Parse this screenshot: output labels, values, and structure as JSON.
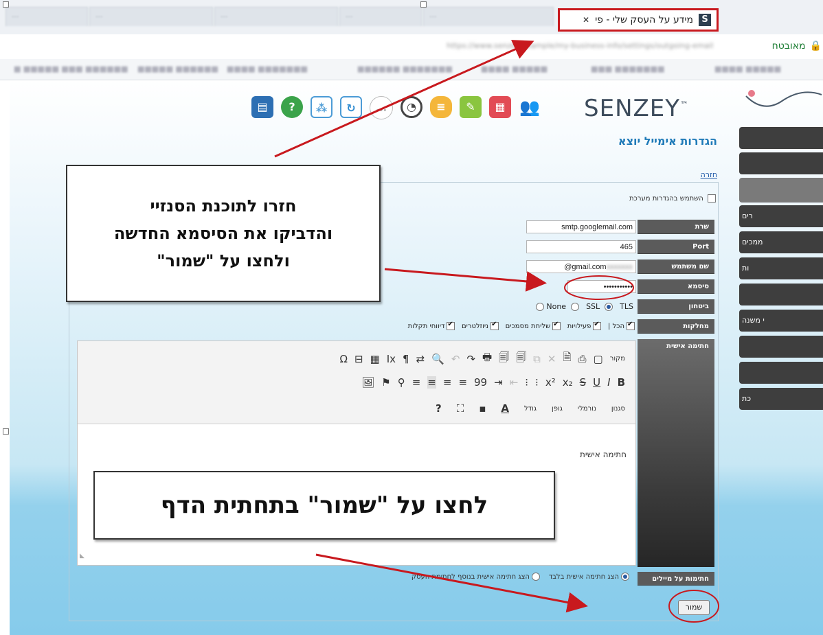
{
  "browser": {
    "active_tab_title": "מידע על העסק שלי - פי",
    "active_tab_favicon": "S",
    "close_label": "✕",
    "secure_label": "מאובטח",
    "background_tabs": [
      "···",
      "···",
      "···",
      "···",
      "···"
    ]
  },
  "app": {
    "logo_text": "SENZEY",
    "logo_mark": "™",
    "toolbar_icons": [
      "contacts-icon",
      "help-icon",
      "feet-icon",
      "sync-icon",
      "chat-bubble-icon",
      "clock-icon",
      "messages-icon",
      "notes-icon",
      "calendar-icon",
      "users-icon"
    ],
    "sidebar_items": [
      "",
      "",
      "",
      "רים",
      "ממכים",
      "ות",
      "",
      "י משנה",
      "",
      "",
      "כת"
    ]
  },
  "settings": {
    "title": "הגדרות אימייל יוצא",
    "help_link": "חזרה",
    "use_system_label": "השתמש בהגדרות מערכת",
    "fields": {
      "server_label": "שרת",
      "server_value": "smtp.googlemail.com",
      "port_label": "Port",
      "port_value": "465",
      "user_label": "שם משתמש",
      "user_value": "@gmail.com",
      "password_label": "סיסמא",
      "password_value": "•••••••••••",
      "security_label": "ביטחון",
      "departments_label": "מחלקות",
      "signature_label": "חתימה אישית",
      "signature_mode_label": "חתימות על מיילים"
    },
    "security_options": [
      {
        "label": "None"
      },
      {
        "label": "SSL"
      },
      {
        "label": "TLS"
      }
    ],
    "departments": [
      {
        "label": "הכל |"
      },
      {
        "label": "פעילויות"
      },
      {
        "label": "שליחת מסמכים"
      },
      {
        "label": "ניוזלטרים"
      },
      {
        "label": "דיווחי תקלות"
      }
    ],
    "editor": {
      "row1": [
        "מקור",
        "▢",
        "⎙",
        "🗎",
        "✕",
        "⧉",
        "🗐",
        "🗐",
        "🖶",
        "↷",
        "↶",
        "🔍",
        "⇄",
        "¶",
        "Ix",
        "▦",
        "⊟",
        "Ω"
      ],
      "row2": [
        "B",
        "I",
        "U",
        "S",
        "x₂",
        "x²",
        "⁝",
        "⁝",
        "⇤",
        "⇥",
        "99",
        "≡",
        "≡",
        "≡",
        "≡",
        "⚲",
        "⚑",
        "🖼"
      ],
      "row3": [
        "סגנון",
        "נורמלי",
        "גופן",
        "גודל",
        "A",
        "▪",
        "⛶",
        "?"
      ],
      "content": "חתימה אישית"
    },
    "signature_options": [
      {
        "label": "הצג חתימה אישית בלבד"
      },
      {
        "label": "הצג חתימה אישית בנוסף לחתימת העסק"
      }
    ],
    "save_label": "שמור"
  },
  "callouts": {
    "top_line1": "חזרו לתוכנת הסנזיי",
    "top_line2": "והדביקו את הסיסמא החדשה",
    "top_line3": "ולחצו על \"שמור\"",
    "bottom": "לחצו על \"שמור\" בתחתית הדף"
  },
  "colors": {
    "highlight_red": "#c8191e",
    "link_blue": "#1f7ab8",
    "label_gray": "#5b5b5b"
  }
}
